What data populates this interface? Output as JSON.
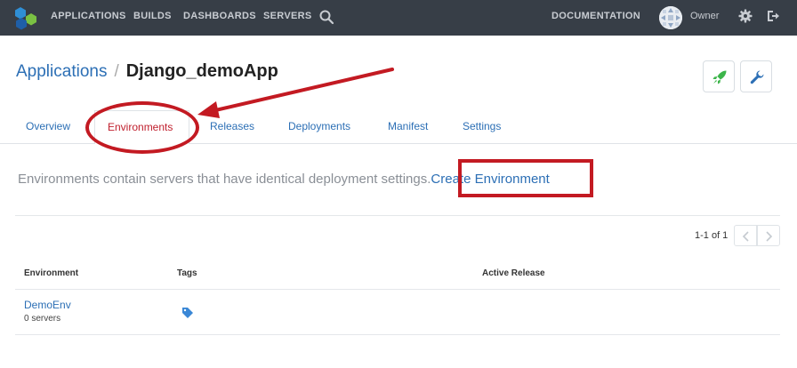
{
  "topnav": {
    "items": [
      "APPLICATIONS",
      "BUILDS",
      "DASHBOARDS",
      "SERVERS"
    ],
    "documentation": "DOCUMENTATION",
    "user": "Owner"
  },
  "breadcrumb": {
    "parent": "Applications",
    "separator": "/",
    "current": "Django_demoApp"
  },
  "tabs": [
    "Overview",
    "Environments",
    "Releases",
    "Deployments",
    "Manifest",
    "Settings"
  ],
  "active_tab": "Environments",
  "intro": {
    "text": "Environments contain servers that have identical deployment settings.",
    "link": "Create Environment"
  },
  "pagination": {
    "info": "1-1 of 1"
  },
  "table": {
    "columns": [
      "Environment",
      "Tags",
      "Active Release"
    ],
    "rows": [
      {
        "name": "DemoEnv",
        "servers": "0 servers",
        "tags_icon": "tag-icon",
        "active_release": ""
      }
    ]
  },
  "icons": {
    "logo": "app-logo-icon",
    "search": "search-icon",
    "gear": "gear-icon",
    "logout": "logout-icon",
    "rocket": "rocket-icon",
    "wrench": "wrench-icon"
  },
  "colors": {
    "nav_bg": "#373e47",
    "link": "#2c6fb5",
    "active_tab": "#c0202e",
    "annotation": "#c31a22",
    "rocket": "#3cb54a"
  }
}
